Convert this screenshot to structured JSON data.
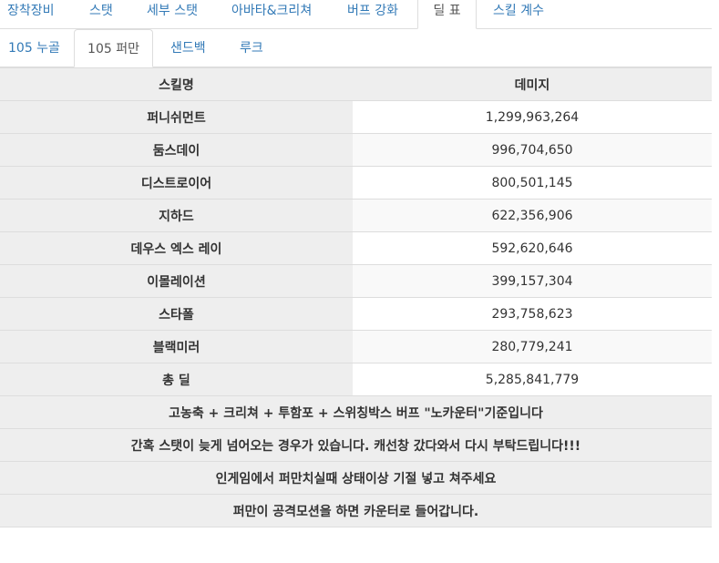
{
  "tabs": [
    {
      "label": "장착장비"
    },
    {
      "label": "스탯"
    },
    {
      "label": "세부 스탯"
    },
    {
      "label": "아바타&크리쳐"
    },
    {
      "label": "버프 강화"
    },
    {
      "label": "딜 표"
    },
    {
      "label": "스킬 계수"
    }
  ],
  "subtabs": [
    {
      "label": "105 누골"
    },
    {
      "label": "105 퍼만"
    },
    {
      "label": "샌드백"
    },
    {
      "label": "루크"
    }
  ],
  "table": {
    "header": {
      "skill": "스킬명",
      "damage": "데미지"
    },
    "rows": [
      {
        "skill": "퍼니쉬먼트",
        "damage": "1,299,963,264"
      },
      {
        "skill": "둠스데이",
        "damage": "996,704,650"
      },
      {
        "skill": "디스트로이어",
        "damage": "800,501,145"
      },
      {
        "skill": "지하드",
        "damage": "622,356,906"
      },
      {
        "skill": "데우스 엑스 레이",
        "damage": "592,620,646"
      },
      {
        "skill": "이몰레이션",
        "damage": "399,157,304"
      },
      {
        "skill": "스타폴",
        "damage": "293,758,623"
      },
      {
        "skill": "블랙미러",
        "damage": "280,779,241"
      },
      {
        "skill": "총 딜",
        "damage": "5,285,841,779"
      }
    ],
    "notes": [
      "고농축 + 크리쳐 + 투함포 + 스위칭박스 버프 \"노카운터\"기준입니다",
      "간혹 스탯이 늦게 넘어오는 경우가 있습니다. 캐선창 갔다와서 다시 부탁드립니다!!!",
      "인게임에서 퍼만치실때 상태이상 기절 넣고 쳐주세요",
      "퍼만이 공격모션을 하면 카운터로 들어갑니다."
    ]
  }
}
